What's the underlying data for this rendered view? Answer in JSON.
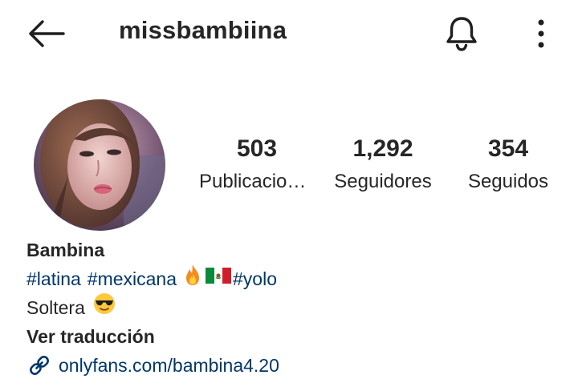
{
  "header": {
    "username": "missbambiina",
    "back_icon": "arrow-left-icon",
    "bell_icon": "bell-icon",
    "more_icon": "more-vertical-icon"
  },
  "stats": {
    "posts_count": "503",
    "posts_label": "Publicaciones",
    "followers_count": "1,292",
    "followers_label": "Seguidores",
    "following_count": "354",
    "following_label": "Seguidos"
  },
  "bio": {
    "name": "Bambina",
    "hashtags": [
      "#latina",
      "#mexicana",
      "#yolo"
    ],
    "status": "Soltera",
    "translate_label": "Ver traducción",
    "link": "onlyfans.com/bambina4.20"
  },
  "colors": {
    "text": "#262626",
    "link": "#00376b",
    "background": "#ffffff"
  }
}
